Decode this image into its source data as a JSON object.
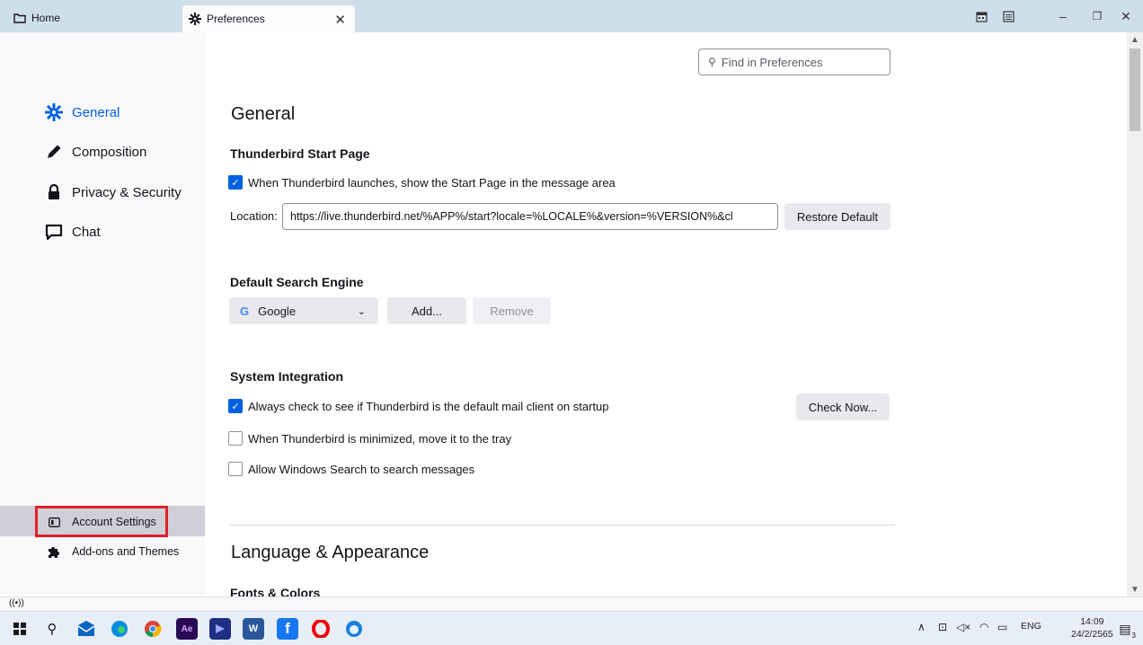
{
  "tabs": {
    "home_label": "Home",
    "pref_label": "Preferences"
  },
  "search": {
    "placeholder": "Find in Preferences"
  },
  "sidebar": {
    "categories": [
      {
        "label": "General",
        "icon": "gear-icon"
      },
      {
        "label": "Composition",
        "icon": "pencil-icon"
      },
      {
        "label": "Privacy & Security",
        "icon": "lock-icon"
      },
      {
        "label": "Chat",
        "icon": "chat-icon"
      }
    ],
    "account_settings": "Account Settings",
    "addons": "Add-ons and Themes"
  },
  "general": {
    "title": "General",
    "start_page": {
      "heading": "Thunderbird Start Page",
      "checkbox_label": "When Thunderbird launches, show the Start Page in the message area",
      "checked": true,
      "location_label": "Location:",
      "location_value": "https://live.thunderbird.net/%APP%/start?locale=%LOCALE%&version=%VERSION%&cl",
      "restore_label": "Restore Default"
    },
    "search_engine": {
      "heading": "Default Search Engine",
      "selected": "Google",
      "add_label": "Add...",
      "remove_label": "Remove"
    },
    "system": {
      "heading": "System Integration",
      "check1": "Always check to see if Thunderbird is the default mail client on startup",
      "check1_on": true,
      "check_now_label": "Check Now...",
      "check2": "When Thunderbird is minimized, move it to the tray",
      "check3": "Allow Windows Search to search messages"
    }
  },
  "language": {
    "title": "Language & Appearance",
    "fonts_heading": "Fonts & Colors"
  },
  "taskbar": {
    "tray_lang": "ENG",
    "time": "14:09",
    "date": "24/2/2565",
    "notif_count": "3"
  },
  "colors": {
    "accent": "#0061e0",
    "highlight_box": "#e0202a"
  }
}
